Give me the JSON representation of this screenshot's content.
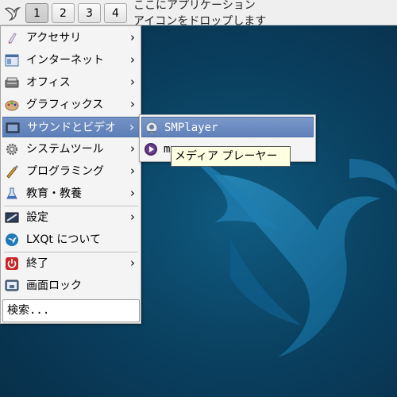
{
  "panel": {
    "desktops": [
      "1",
      "2",
      "3",
      "4"
    ],
    "active_desktop": "1",
    "drop_hint": "ここにアプリケーション\nアイコンをドロップします"
  },
  "menu": {
    "items": [
      {
        "label": "アクセサリ",
        "icon": "accessories-icon",
        "submenu": true
      },
      {
        "label": "インターネット",
        "icon": "internet-icon",
        "submenu": true
      },
      {
        "label": "オフィス",
        "icon": "office-icon",
        "submenu": true
      },
      {
        "label": "グラフィックス",
        "icon": "graphics-icon",
        "submenu": true
      },
      {
        "label": "サウンドとビデオ",
        "icon": "sound-video-icon",
        "submenu": true
      },
      {
        "label": "システムツール",
        "icon": "system-tools-icon",
        "submenu": true
      },
      {
        "label": "プログラミング",
        "icon": "programming-icon",
        "submenu": true
      },
      {
        "label": "教育・教養",
        "icon": "education-icon",
        "submenu": true
      },
      {
        "label": "設定",
        "icon": "settings-icon",
        "submenu": true
      },
      {
        "label": "LXQt について",
        "icon": "lxqt-about-icon",
        "submenu": false
      },
      {
        "label": "終了",
        "icon": "leave-icon",
        "submenu": true
      },
      {
        "label": "画面ロック",
        "icon": "lock-screen-icon",
        "submenu": false
      }
    ],
    "arrow": "›",
    "search_label": "検索..."
  },
  "submenu": {
    "items": [
      {
        "label": "SMPlayer",
        "icon": "smplayer-icon"
      },
      {
        "label": "mp",
        "icon": "mpv-icon"
      }
    ]
  },
  "tooltip": {
    "text": "メディア プレーヤー"
  },
  "colors": {
    "highlight": "#5c7fb8",
    "desktop_bg": "#0a4060",
    "panel_bg": "#efefef",
    "menu_bg": "#f4f4f4",
    "tooltip_bg": "#ffffe1"
  }
}
